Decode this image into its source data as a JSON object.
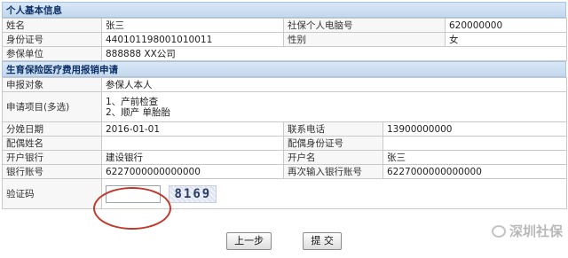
{
  "section1": {
    "title": "个人基本信息",
    "name_label": "姓名",
    "name_value": "张三",
    "phone_label": "社保个人电脑号",
    "phone_value": "620000000",
    "id_label": "身份证号",
    "id_value": "440101198001010011",
    "gender_label": "性别",
    "gender_value": "女",
    "employer_label": "参保单位",
    "employer_value": "888888 XX公司"
  },
  "section2": {
    "title": "生育保险医疗费用报销申请",
    "applicant_label": "申报对象",
    "applicant_value": "参保人本人",
    "items_label": "申请项目(多选)",
    "items": [
      "1、产前检查",
      "2、顺产 单胎胎"
    ],
    "delivery_date_label": "分娩日期",
    "delivery_date_value": "2016-01-01",
    "contact_label": "联系电话",
    "contact_value": "13900000000",
    "spouse_name_label": "配偶姓名",
    "spouse_name_value": "",
    "spouse_id_label": "配偶身份证号",
    "spouse_id_value": "",
    "bank_label": "开户银行",
    "bank_value": "建设银行",
    "account_name_label": "开户名",
    "account_name_value": "张三",
    "account_no_label": "银行账号",
    "account_no_value": "6227000000000000",
    "account_no_confirm_label": "再次输入银行账号",
    "account_no_confirm_value": "6227000000000000",
    "captcha_label": "验证码",
    "captcha_text": "8169"
  },
  "buttons": {
    "prev": "上一步",
    "submit": "提 交"
  },
  "watermark": "深圳社保",
  "colors": {
    "section_header": "#c3d8ee",
    "highlight_circle": "#c0392b"
  }
}
